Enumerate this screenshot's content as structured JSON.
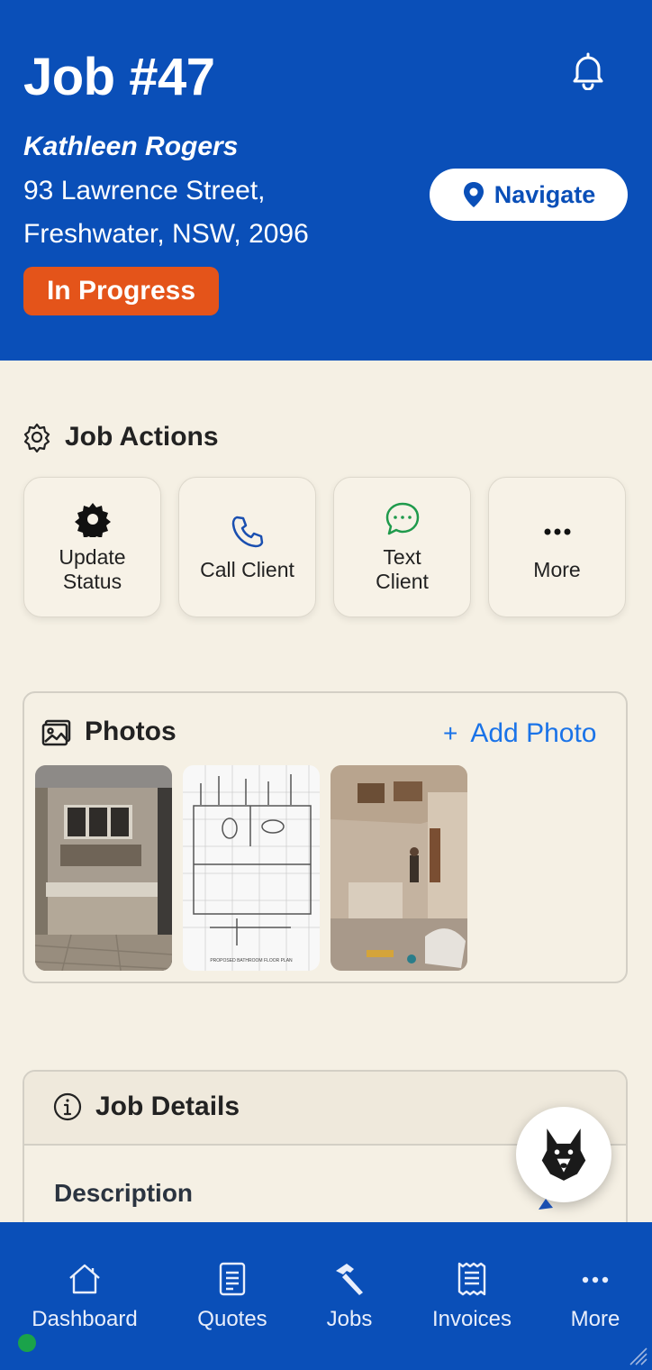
{
  "header": {
    "job_title": "Job #47",
    "client_name": "Kathleen Rogers",
    "address_line1": "93 Lawrence Street,",
    "address_line2": "Freshwater, NSW, 2096",
    "navigate_label": "Navigate",
    "status": "In Progress",
    "status_color": "#e4541a",
    "brand_color": "#0a4fb8"
  },
  "job_actions": {
    "heading": "Job Actions",
    "items": [
      {
        "label": "Update\nStatus",
        "icon": "gear-icon"
      },
      {
        "label": "Call Client",
        "icon": "phone-icon"
      },
      {
        "label": "Text\nClient",
        "icon": "chat-icon"
      },
      {
        "label": "More",
        "icon": "ellipsis-icon"
      }
    ]
  },
  "photos": {
    "heading": "Photos",
    "add_label": "Add Photo",
    "add_icon": "+",
    "floor_plan_caption": "PROPOSED BATHROOM FLOOR PLAN"
  },
  "job_details": {
    "heading": "Job Details",
    "description_label": "Description"
  },
  "bottom_nav": {
    "items": [
      {
        "label": "Dashboard",
        "icon": "home-icon"
      },
      {
        "label": "Quotes",
        "icon": "document-icon"
      },
      {
        "label": "Jobs",
        "icon": "hammer-icon"
      },
      {
        "label": "Invoices",
        "icon": "receipt-icon"
      },
      {
        "label": "More",
        "icon": "ellipsis-icon"
      }
    ]
  }
}
